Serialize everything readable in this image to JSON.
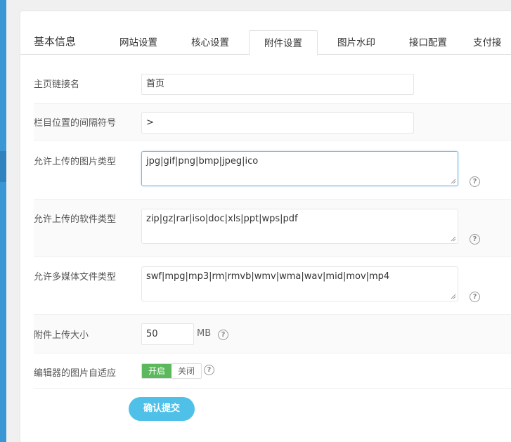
{
  "tabs": {
    "title": "基本信息",
    "items": [
      {
        "label": "网站设置"
      },
      {
        "label": "核心设置"
      },
      {
        "label": "附件设置"
      },
      {
        "label": "图片水印"
      },
      {
        "label": "接口配置"
      },
      {
        "label": "支付接"
      }
    ],
    "active_index": 2
  },
  "form": {
    "home_link_label": "主页链接名",
    "home_link_value": "首页",
    "separator_label": "栏目位置的间隔符号",
    "separator_value": ">",
    "image_types_label": "允许上传的图片类型",
    "image_types_value": "jpg|gif|png|bmp|jpeg|ico",
    "soft_types_label": "允许上传的软件类型",
    "soft_types_value": "zip|gz|rar|iso|doc|xls|ppt|wps|pdf",
    "media_types_label": "允许多媒体文件类型",
    "media_types_value": "swf|mpg|mp3|rm|rmvb|wmv|wma|wav|mid|mov|mp4",
    "upload_size_label": "附件上传大小",
    "upload_size_value": "50",
    "upload_size_unit": "MB",
    "editor_adapt_label": "编辑器的图片自适应",
    "switch_on_label": "开启",
    "switch_off_label": "关闭",
    "help_glyph": "?",
    "submit_label": "确认提交"
  },
  "colors": {
    "accent": "#3a97d4",
    "switch_on": "#5cb85c",
    "submit": "#4fc1e8"
  },
  "icons": {
    "help": "question-circle-icon",
    "resize": "resize-grip-icon"
  }
}
